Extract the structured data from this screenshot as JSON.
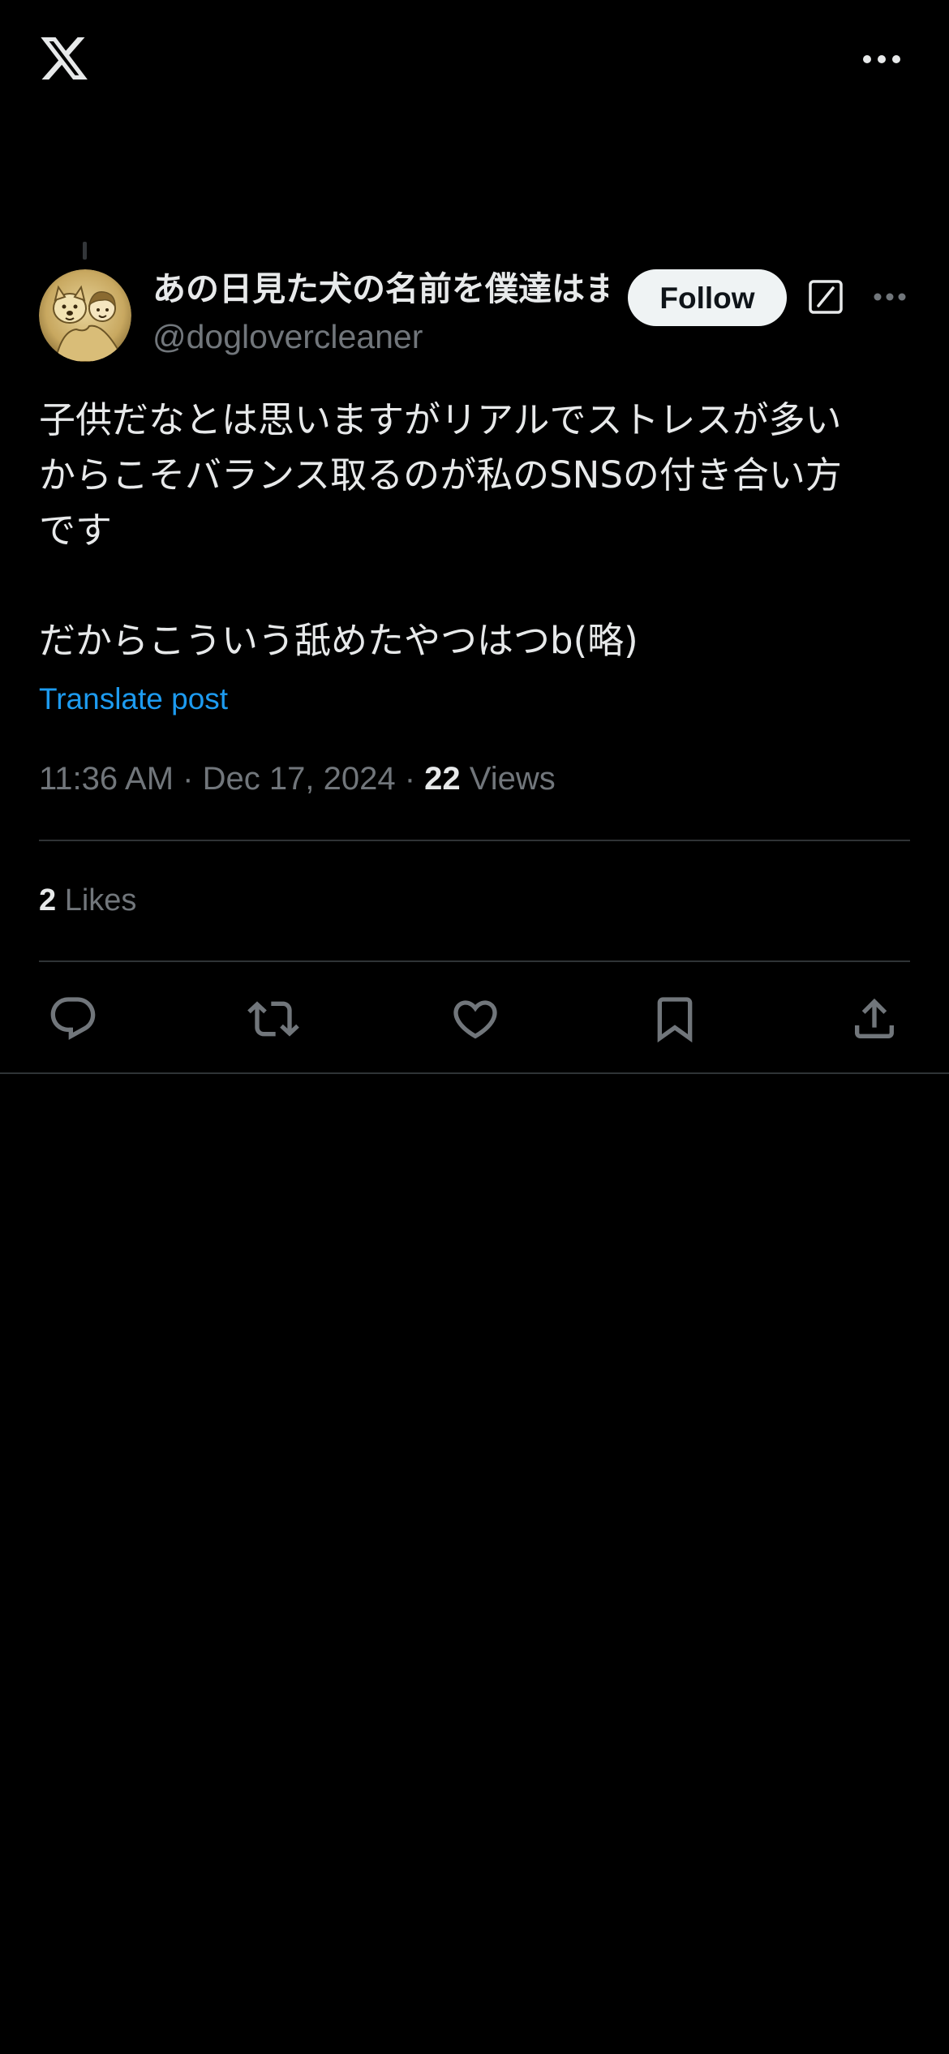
{
  "topbar": {
    "logo_icon": "x-logo-icon",
    "more_icon": "more-horizontal-icon"
  },
  "author": {
    "display_name": "あの日見た犬の名前を僕達はまだ知らない",
    "handle": "@doglovercleaner",
    "avatar_icon": "dog-avatar-icon"
  },
  "header": {
    "follow_label": "Follow",
    "grok_icon": "grok-icon",
    "more_icon": "more-horizontal-icon"
  },
  "post": {
    "text": "子供だなとは思いますがリアルでストレスが多い\nからこそバランス取るのが私のSNSの付き合い方\nです\n\nだからこういう舐めたやつはつb(略)",
    "translate_label": "Translate post",
    "time": "11:36 AM",
    "date": "Dec 17, 2024",
    "views_count": "22",
    "views_label": "Views"
  },
  "stats": {
    "likes_count": "2",
    "likes_label": "Likes"
  },
  "actions": [
    {
      "icon": "reply-icon"
    },
    {
      "icon": "repost-icon"
    },
    {
      "icon": "like-icon"
    },
    {
      "icon": "bookmark-icon"
    },
    {
      "icon": "share-icon"
    }
  ],
  "colors": {
    "background": "#000000",
    "text_primary": "#e7e9ea",
    "text_secondary": "#71767b",
    "link": "#1d9bf0",
    "divider": "#2f3336",
    "follow_bg": "#eff3f4"
  }
}
